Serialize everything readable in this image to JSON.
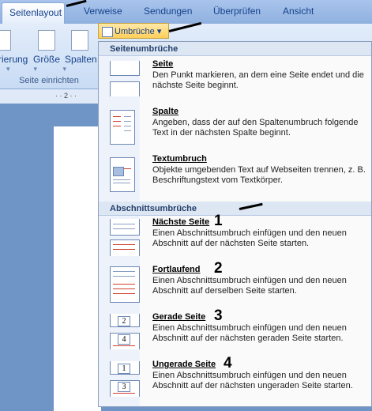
{
  "tabs": [
    "Seitenlayout",
    "Verweise",
    "Sendungen",
    "Überprüfen",
    "Ansicht"
  ],
  "ribbon": {
    "buttons": [
      "rierung",
      "Größe",
      "Spalten"
    ],
    "group_label": "Seite einrichten",
    "umbruche_label": "Umbrüche",
    "umbruche_arrow": "▾"
  },
  "ruler": {
    "text": "· · 2 · ·"
  },
  "menu": {
    "seitenumbruche_header": "Seitenumbrüche",
    "abschnitt_header": "Abschnittsumbrüche",
    "items": [
      {
        "title": "Seite",
        "description": "Den Punkt markieren, an dem eine Seite endet und die nächste Seite beginnt.",
        "number": ""
      },
      {
        "title": "Spalte",
        "description": "Angeben, dass der auf den Spaltenumbruch folgende Text in der nächsten Spalte beginnt.",
        "number": ""
      },
      {
        "title": "Textumbruch",
        "description": "Objekte umgebenden Text auf Webseiten trennen, z. B. Beschriftungstext vom Textkörper.",
        "number": ""
      },
      {
        "title": "Nächste Seite",
        "description": "Einen Abschnittsumbruch einfügen und den neuen Abschnitt auf der nächsten Seite starten.",
        "number": "1"
      },
      {
        "title": "Fortlaufend",
        "description": "Einen Abschnittsumbruch einfügen und den neuen Abschnitt auf derselben Seite starten.",
        "number": "2"
      },
      {
        "title": "Gerade Seite",
        "description": "Einen Abschnittsumbruch einfügen und den neuen Abschnitt auf der nächsten geraden Seite starten.",
        "number": "3"
      },
      {
        "title": "Ungerade Seite",
        "description": "Einen Abschnittsumbruch einfügen und den neuen Abschnitt auf der nächsten ungeraden Seite starten.",
        "number": "4"
      }
    ],
    "icon_numbers": {
      "gerade_top": "2",
      "gerade_bottom": "4",
      "ungerade_top": "1",
      "ungerade_bottom": "3"
    }
  },
  "icons": [
    "page-break-icon",
    "column-break-icon",
    "text-wrapping-icon",
    "next-page-icon",
    "continuous-icon",
    "even-page-icon",
    "odd-page-icon"
  ]
}
